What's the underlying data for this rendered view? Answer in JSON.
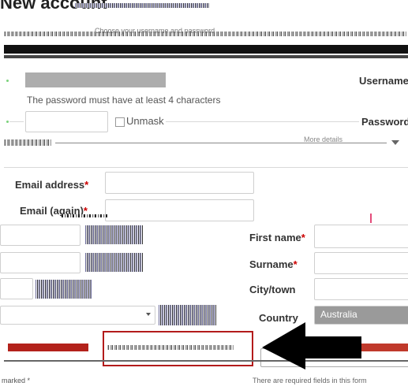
{
  "page": {
    "title": "New account",
    "subtitle_noise": "Choose your username and password"
  },
  "user_section": {
    "password_hint": "The password must have at least 4 characters",
    "unmask_label": "Unmask",
    "username_label": "Username",
    "password_label": "Password"
  },
  "more_details": {
    "heading": "More details"
  },
  "fields": {
    "email_label": "Email address",
    "email_again_label": "Email (again)",
    "first_name_label": "First name",
    "surname_label": "Surname",
    "city_label": "City/town",
    "country_label": "Country",
    "country_value": "Australia",
    "required_marker": "*"
  },
  "footer": {
    "left_note": "marked *",
    "right_note": "There are required fields in this form"
  },
  "annotation": {
    "arrow_color": "#000000",
    "box_color": "#b31b1b"
  },
  "colors": {
    "required": "#cc0000",
    "accent_red": "#c0392b",
    "label": "#333333"
  }
}
